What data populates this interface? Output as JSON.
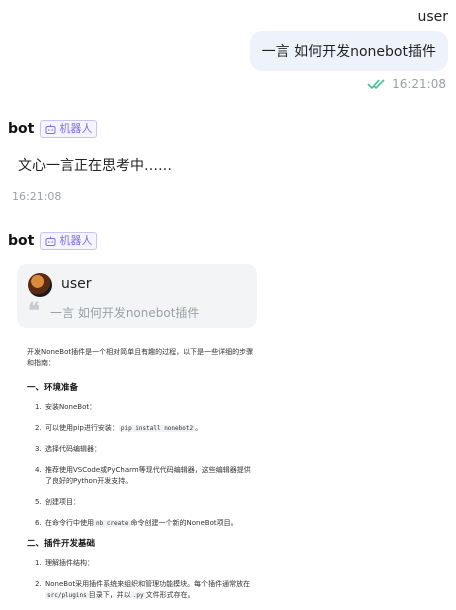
{
  "user_message": {
    "name": "user",
    "text": "一言 如何开发nonebot插件",
    "time": "16:21:08"
  },
  "bot_message_1": {
    "name": "bot",
    "tag": "机器人",
    "text": "文心一言正在思考中……",
    "time": "16:21:08"
  },
  "bot_message_2": {
    "name": "bot",
    "tag": "机器人",
    "quote": {
      "user": "user",
      "text": "一言 如何开发nonebot插件"
    },
    "doc": {
      "intro": "开发NoneBot插件是一个相对简单且有趣的过程，以下是一些详细的步骤和指南：",
      "section1_title": "一、环境准备",
      "section1_items": [
        {
          "num": "1.",
          "text": "安装NoneBot："
        },
        {
          "num": "2.",
          "pre": "可以使用pip进行安装：",
          "code": "pip install nonebot2",
          "post": "。"
        },
        {
          "num": "3.",
          "text": "选择代码编辑器："
        },
        {
          "num": "4.",
          "text": "推荐使用VSCode或PyCharm等现代代码编辑器，这些编辑器提供了良好的Python开发支持。"
        },
        {
          "num": "5.",
          "text": "创建项目："
        },
        {
          "num": "6.",
          "pre": "在命令行中使用",
          "code": "nb create",
          "post": "命令创建一个新的NoneBot项目。"
        }
      ],
      "section2_title": "二、插件开发基础",
      "section2_items": [
        {
          "num": "1.",
          "text": "理解插件结构："
        },
        {
          "num": "2.",
          "pre": "NoneBot采用插件系统来组织和管理功能模块。每个插件通常放在",
          "code": "src/plugins",
          "mid": "目录下，并以",
          "code2": ".py",
          "post": "文件形式存在。"
        }
      ]
    }
  },
  "colors": {
    "user_bubble": "#eef3fb",
    "tag_purple": "#7b6fe0",
    "check_green": "#3ec28f",
    "muted": "#9aa0a6"
  }
}
